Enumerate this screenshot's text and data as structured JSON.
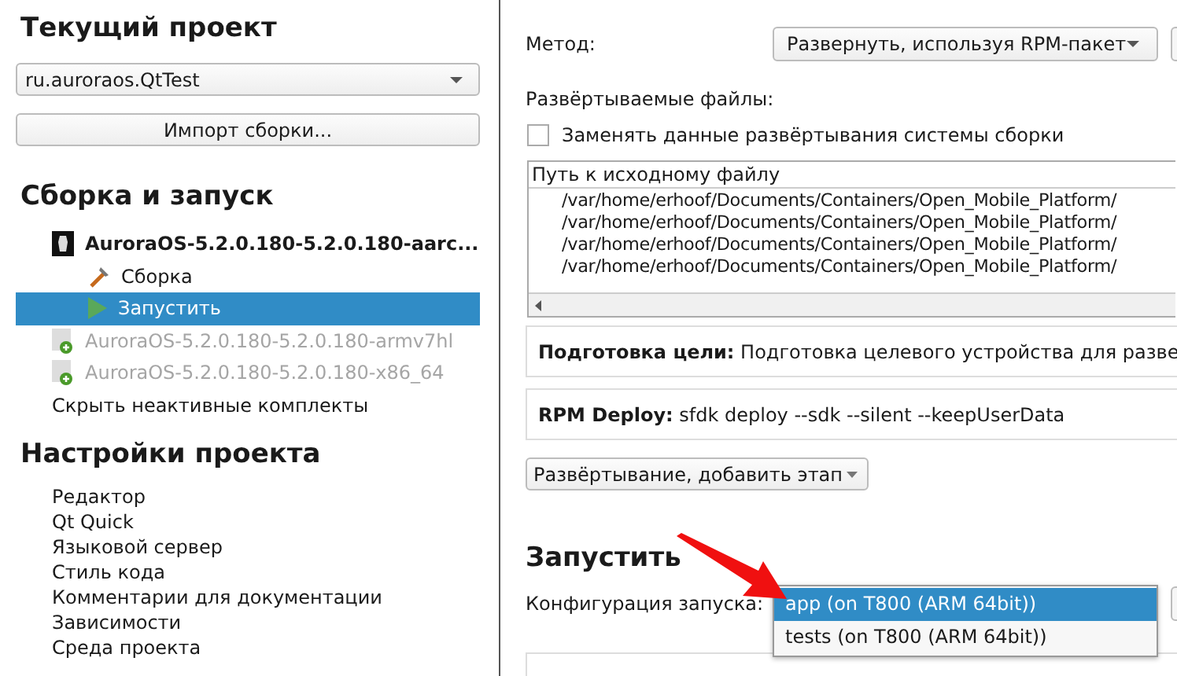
{
  "current_project": {
    "title": "Текущий проект",
    "project": {
      "value": "ru.auroraos.QtTest"
    },
    "import_button": "Импорт сборки..."
  },
  "build_run": {
    "title": "Сборка и запуск",
    "kits": [
      {
        "name": "AuroraOS-5.2.0.180-5.2.0.180-aarc...",
        "active": true,
        "steps": [
          {
            "kind": "build",
            "label": "Сборка",
            "selected": false
          },
          {
            "kind": "run",
            "label": "Запустить",
            "selected": true
          }
        ]
      },
      {
        "name": "AuroraOS-5.2.0.180-5.2.0.180-armv7hl",
        "active": false
      },
      {
        "name": "AuroraOS-5.2.0.180-5.2.0.180-x86_64",
        "active": false
      }
    ],
    "hide_link": "Скрыть неактивные комплекты"
  },
  "project_settings": {
    "title": "Настройки проекта",
    "items": [
      "Редактор",
      "Qt Quick",
      "Языковой сервер",
      "Стиль кода",
      "Комментарии для документации",
      "Зависимости",
      "Среда проекта"
    ]
  },
  "deployment": {
    "method_label": "Метод:",
    "method": {
      "value": "Развернуть, используя RPM-пакет"
    },
    "files_label": "Развёртываемые файлы:",
    "override": {
      "label": "Заменять данные развёртывания системы сборки",
      "checked": false
    },
    "files_table": {
      "columns": [
        "Путь к исходному файлу"
      ],
      "rows": [
        "/var/home/erhoof/Documents/Containers/Open_Mobile_Platform/",
        "/var/home/erhoof/Documents/Containers/Open_Mobile_Platform/",
        "/var/home/erhoof/Documents/Containers/Open_Mobile_Platform/",
        "/var/home/erhoof/Documents/Containers/Open_Mobile_Platform/"
      ]
    },
    "steps": [
      "**Подготовка цели:** Подготовка целевого устройства для разве",
      "**RPM Deploy:** sfdk deploy --sdk --silent --keepUserData"
    ],
    "add_step_button": "Развёртывание, добавить этап"
  },
  "run": {
    "title": "Запустить",
    "config_label": "Конфигурация запуска:",
    "config_options": [
      {
        "label": "app (on T800 (ARM 64bit))",
        "selected": true
      },
      {
        "label": "tests (on T800 (ARM 64bit))",
        "selected": false
      }
    ]
  }
}
